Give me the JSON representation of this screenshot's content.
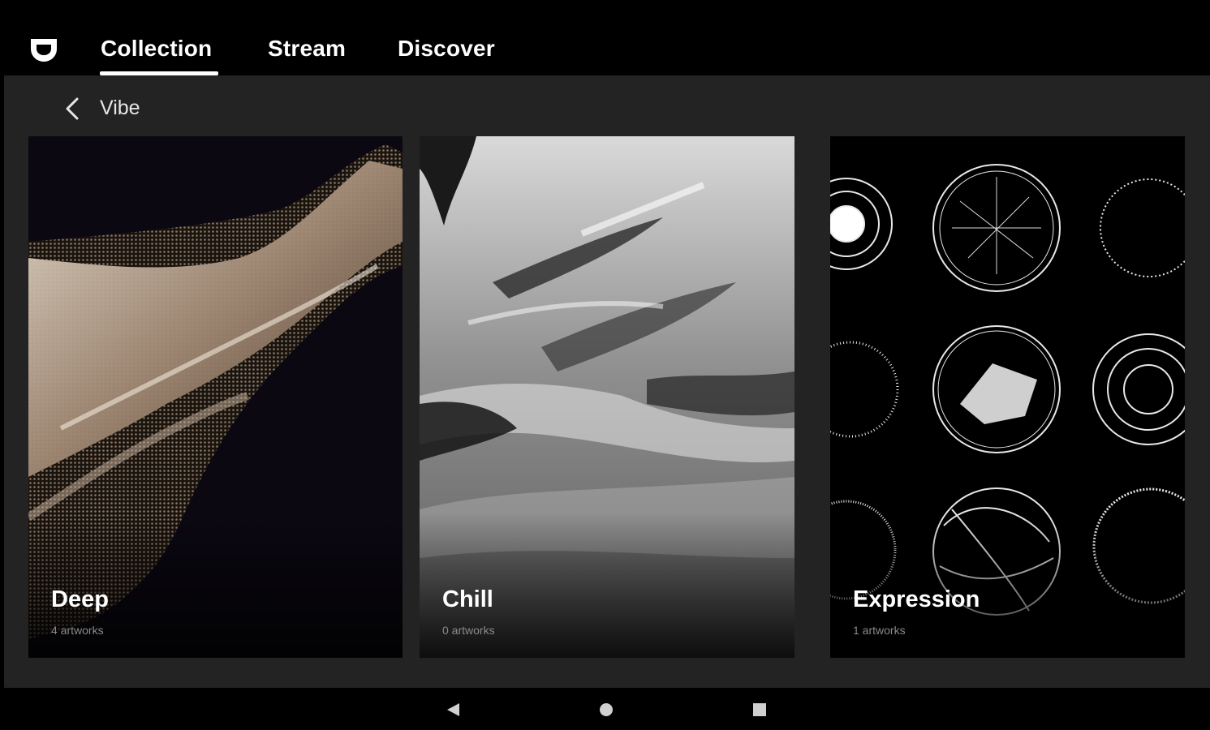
{
  "header": {
    "tabs": [
      {
        "label": "Collection",
        "active": true
      },
      {
        "label": "Stream",
        "active": false
      },
      {
        "label": "Discover",
        "active": false
      }
    ],
    "logo_icon": "shield-logo-icon"
  },
  "breadcrumb": {
    "back_icon": "chevron-left-icon",
    "label": "Vibe"
  },
  "cards": [
    {
      "title": "Deep",
      "subtitle": "4 artworks"
    },
    {
      "title": "Chill",
      "subtitle": "0 artworks"
    },
    {
      "title": "Expression",
      "subtitle": "1 artworks"
    }
  ],
  "system_nav": {
    "back_icon": "triangle-back-icon",
    "home_icon": "circle-home-icon",
    "recents_icon": "square-recents-icon"
  },
  "colors": {
    "background": "#000000",
    "content_bg": "#232323",
    "text_primary": "#ffffff",
    "text_secondary": "#8a8a8a"
  }
}
